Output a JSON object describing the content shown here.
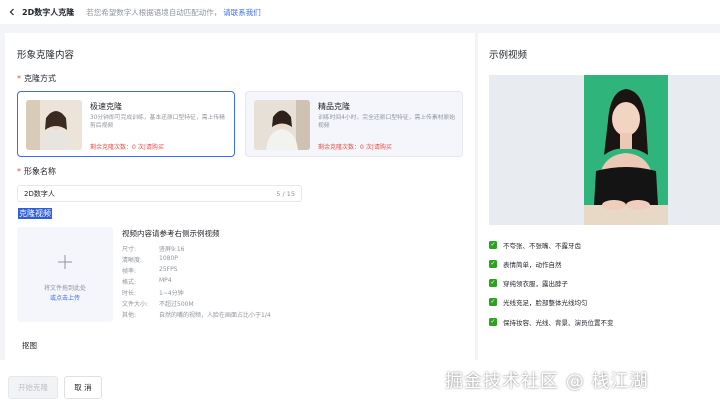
{
  "header": {
    "back_icon": "chevron-left-icon",
    "title": "2D数字人克隆",
    "hint_text": "若您希望数字人根据语境自动匹配动作，",
    "hint_link": "请联系我们"
  },
  "left": {
    "section_title": "形象克隆内容",
    "method_label": "克隆方式",
    "cards": [
      {
        "name": "极速克隆",
        "desc": "30分钟即可完成训练，基本还原口型特征，需上传精剪后视频",
        "remaining": "剩余克隆次数：0",
        "buy": "次|请购买"
      },
      {
        "name": "精品克隆",
        "desc": "训练时间4小时，完全还原口型特征，需上传素材原始视频",
        "remaining": "剩余克隆次数：0",
        "buy": "次|请购买"
      }
    ],
    "name_label": "形象名称",
    "name_value": "2D数字人",
    "name_count": "5 / 15",
    "video_label": "克隆视频",
    "upload": {
      "plus_icon": "plus-icon",
      "line1": "将文件拖到此处",
      "line2": "或点击上传"
    },
    "requirements_title": "视频内容请参考右侧示例视频",
    "specs": [
      {
        "k": "尺寸:",
        "v": "竖屏9:16"
      },
      {
        "k": "清晰度:",
        "v": "1080P"
      },
      {
        "k": "帧率:",
        "v": "25FPS"
      },
      {
        "k": "格式:",
        "v": "MP4"
      },
      {
        "k": "时长:",
        "v": "1~4分钟"
      },
      {
        "k": "文件大小:",
        "v": "不超过500M"
      },
      {
        "k": "其他:",
        "v": "自然的嘴的视频，人脸在画面占比小于1/4"
      }
    ],
    "keyout_label": "抠图"
  },
  "right": {
    "section_title": "示例视频",
    "checks": [
      "不夸张、不张嘴、不露牙齿",
      "表情简单，动作自然",
      "穿纯领衣服，露出脖子",
      "光线充足，脸部整体光线均匀",
      "保持妆容、光线、背景、演员位置不变"
    ]
  },
  "footer": {
    "start_label": "开始克隆",
    "cancel_label": "取 消"
  },
  "watermark": "掘金技术社区 @ 栈江湖",
  "colors": {
    "accent": "#3b6cf6",
    "check_green": "#2ea121",
    "video_bg": "#2fb57b",
    "warning": "#f54a45"
  }
}
